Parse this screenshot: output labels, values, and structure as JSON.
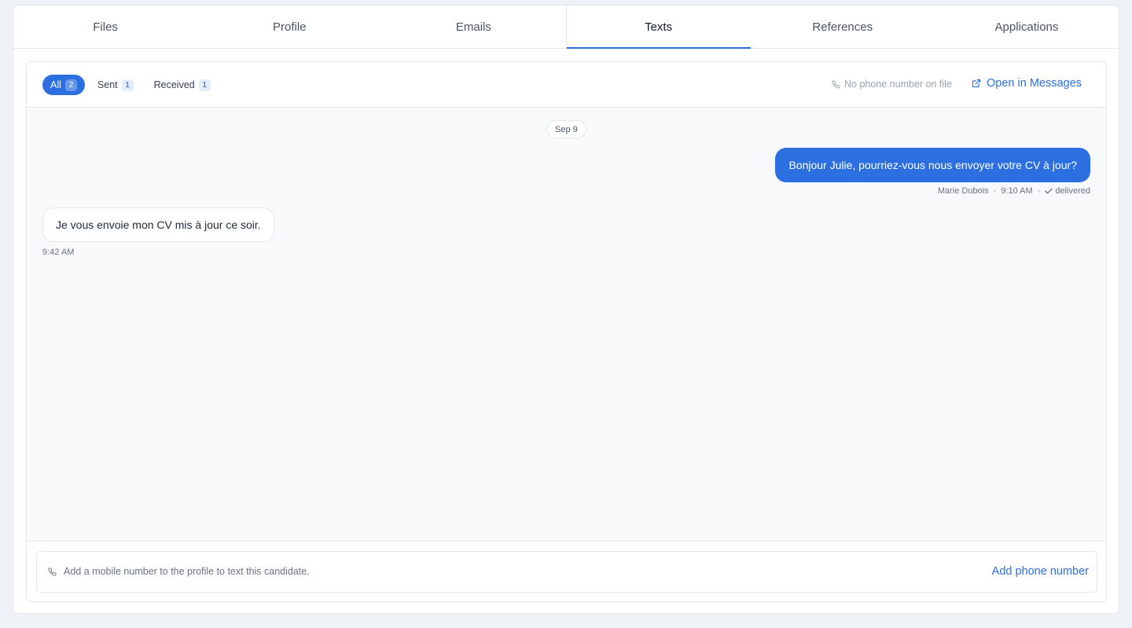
{
  "tabs": [
    {
      "label": "Files"
    },
    {
      "label": "Profile"
    },
    {
      "label": "Emails"
    },
    {
      "label": "Texts",
      "active": true
    },
    {
      "label": "References"
    },
    {
      "label": "Applications"
    }
  ],
  "filters": [
    {
      "label": "All",
      "count": "2",
      "active": true
    },
    {
      "label": "Sent",
      "count": "1"
    },
    {
      "label": "Received",
      "count": "1"
    }
  ],
  "header": {
    "no_phone": "No phone number on file",
    "open_messages": "Open in Messages",
    "phone_icon": "phone-icon",
    "external_icon": "external-link-icon"
  },
  "thread": {
    "date": "Sep 9",
    "outgoing": {
      "text": "Bonjour Julie, pourriez-vous nous envoyer votre CV à jour?",
      "sender": "Marie Dubois",
      "time": "9:10 AM",
      "status": "delivered"
    },
    "incoming": {
      "text": "Je vous envoie mon CV mis à jour ce soir.",
      "time": "9:42 AM"
    }
  },
  "composer": {
    "hint": "Add a mobile number to the profile to text this candidate.",
    "action": "Add phone number"
  },
  "colors": {
    "accent": "#2c6fe0",
    "background": "#eef1f5",
    "thread_bg": "#f8f9fb"
  }
}
